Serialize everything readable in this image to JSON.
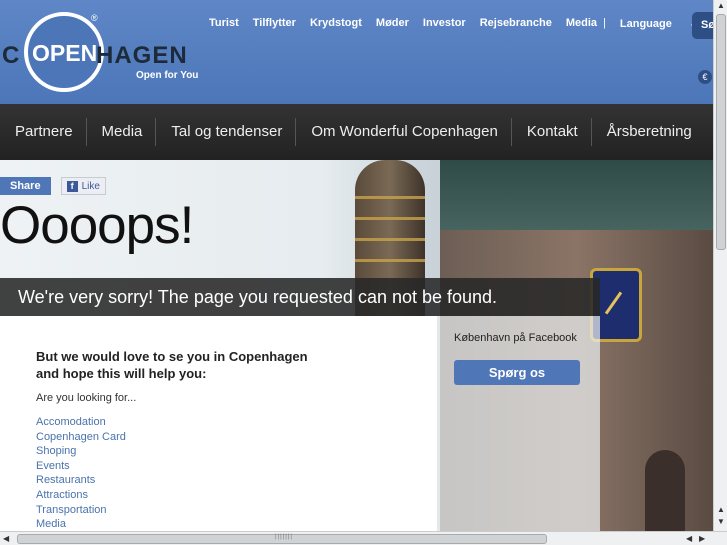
{
  "logo": {
    "c": "C",
    "open": "OPEN",
    "hagen": "HAGEN",
    "registered": "®",
    "tagline": "Open for You"
  },
  "topnav": {
    "items": [
      "Turist",
      "Tilflytter",
      "Krydstogt",
      "Møder",
      "Investor",
      "Rejsebranche",
      "Media"
    ],
    "separator": "|",
    "language": "Language",
    "search_label": "Sø",
    "currency": "€"
  },
  "mainnav": {
    "items": [
      "Partnere",
      "Media",
      "Tal og tendenser",
      "Om Wonderful Copenhagen",
      "Kontakt",
      "Årsberetning"
    ]
  },
  "social": {
    "share": "Share",
    "like": "Like",
    "fb_glyph": "f"
  },
  "page": {
    "title": "Oooops!",
    "sorry": "We're very sorry! The page you requested can not be found.",
    "intro_line1": "But we would love to se you in Copenhagen",
    "intro_line2": "and hope this will help you:",
    "looking_for": "Are you looking for...",
    "links": [
      "Accomodation",
      "Copenhagen Card",
      "Shoping",
      "Events",
      "Restaurants",
      "Attractions",
      "Transportation",
      "Media"
    ]
  },
  "sidebar": {
    "facebook_label": "København på Facebook",
    "ask_button": "Spørg os"
  },
  "scroll": {
    "up": "▲",
    "down": "▼",
    "left": "◀",
    "right": "▶",
    "grip": "|||||||"
  },
  "colors": {
    "header_blue": "#5f87c7",
    "nav_dark": "#2a2a2a",
    "link_blue": "#4a73ad",
    "button_blue": "#4f77b7"
  }
}
